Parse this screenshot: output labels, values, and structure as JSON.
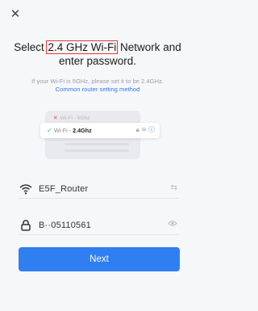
{
  "close_icon": "close-icon",
  "title": {
    "before": "Select ",
    "highlight": "2.4 GHz Wi-Fi",
    "after": " Network and enter password."
  },
  "note": {
    "text": "If your Wi-Fi is 5GHz, please set it to be 2.4GHz.",
    "link": "Common router setting method"
  },
  "illustration": {
    "row_5g": "Wi-Fi - 5Ghz",
    "row_24_prefix": "Wi-Fi - ",
    "row_24_bold": "2.4Ghz"
  },
  "wifi_field": {
    "value": "E5F_Router",
    "icon": "wifi-icon",
    "action_icon": "switch-arrows-icon"
  },
  "password_field": {
    "value": "B··05110561",
    "icon": "lock-icon",
    "action_icon": "eye-icon"
  },
  "next_button": {
    "label": "Next"
  },
  "colors": {
    "accent": "#2f7ff3",
    "highlight_box": "#e23b3b",
    "link": "#2d7bf4"
  }
}
